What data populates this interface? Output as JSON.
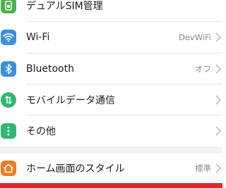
{
  "settings": {
    "items": [
      {
        "label": "デュアルSIM管理",
        "value": "",
        "icon": "dual-sim-icon",
        "color": "#4caf50"
      },
      {
        "label": "Wi-Fi",
        "value": "DevWiFi",
        "icon": "wifi-icon",
        "color": "#3b8fe0"
      },
      {
        "label": "Bluetooth",
        "value": "オフ",
        "icon": "bluetooth-icon",
        "color": "#3b8fe0"
      },
      {
        "label": "モバイルデータ通信",
        "value": "",
        "icon": "mobile-data-icon",
        "color": "#2eb872"
      },
      {
        "label": "その他",
        "value": "",
        "icon": "more-icon",
        "color": "#2eb872"
      },
      {
        "label": "ホーム画面のスタイル",
        "value": "標準",
        "icon": "home-style-icon",
        "color": "#f07a26"
      }
    ]
  },
  "accent_colors": {
    "bottom_bar": "#e0282d",
    "section_gap": "#f2f2f2"
  }
}
